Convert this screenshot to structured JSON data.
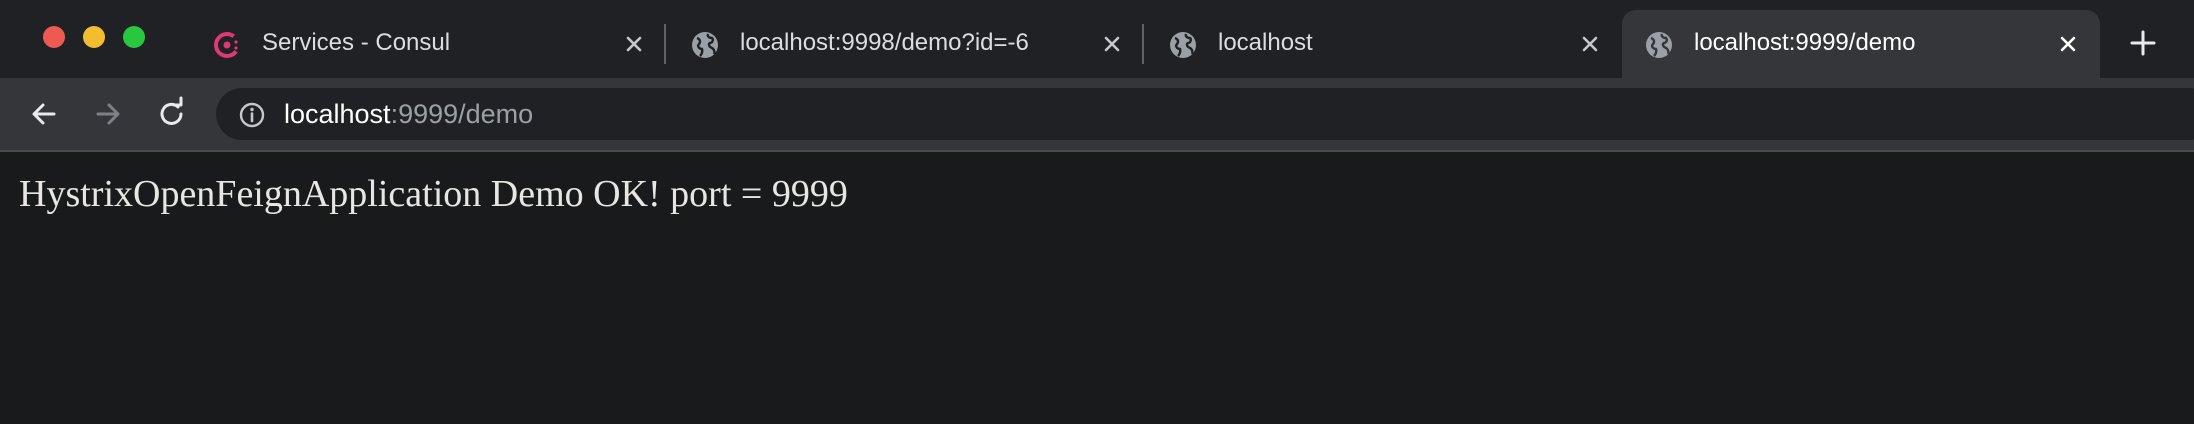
{
  "browser": {
    "tabs": [
      {
        "title": "Services - Consul",
        "icon": "consul-icon",
        "active": false
      },
      {
        "title": "localhost:9998/demo?id=-6",
        "icon": "globe-icon",
        "active": false
      },
      {
        "title": "localhost",
        "icon": "globe-icon",
        "active": false
      },
      {
        "title": "localhost:9999/demo",
        "icon": "globe-icon",
        "active": true
      }
    ],
    "address": {
      "host": "localhost",
      "rest": ":9999/demo"
    },
    "colors": {
      "consul_accent": "#e03875",
      "active_tab": "#35363a"
    }
  },
  "page": {
    "text": "HystrixOpenFeignApplication Demo OK! port = 9999"
  }
}
